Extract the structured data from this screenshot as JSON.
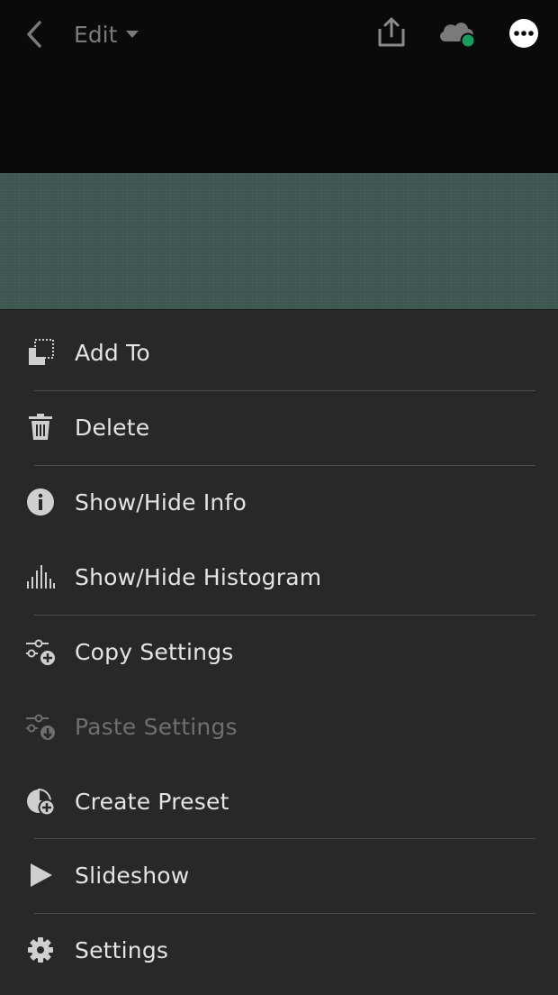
{
  "topbar": {
    "edit_label": "Edit"
  },
  "menu": {
    "items": [
      {
        "label": "Add To",
        "icon": "add-to-icon"
      },
      {
        "label": "Delete",
        "icon": "trash-icon"
      },
      {
        "label": "Show/Hide Info",
        "icon": "info-icon"
      },
      {
        "label": "Show/Hide Histogram",
        "icon": "histogram-icon"
      },
      {
        "label": "Copy Settings",
        "icon": "copy-settings-icon"
      },
      {
        "label": "Paste Settings",
        "icon": "paste-settings-icon",
        "disabled": true
      },
      {
        "label": "Create Preset",
        "icon": "create-preset-icon"
      },
      {
        "label": "Slideshow",
        "icon": "play-icon"
      },
      {
        "label": "Settings",
        "icon": "gear-icon"
      }
    ]
  },
  "colors": {
    "background": "#0a0a0a",
    "menu_background": "#282828",
    "photo": "#3d5650",
    "sync_status": "#1a9c5a",
    "text": "#e4e4e4",
    "text_disabled": "#6f6f6f"
  }
}
